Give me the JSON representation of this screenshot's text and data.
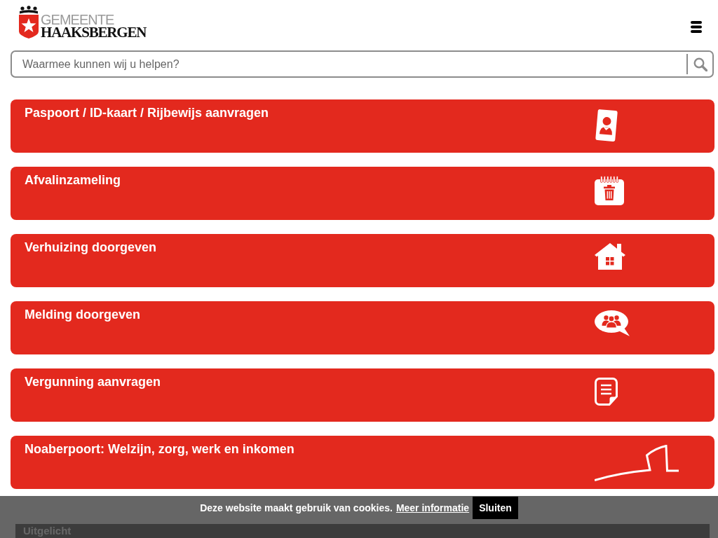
{
  "header": {
    "logo": {
      "line_1": "GEMEENTE",
      "line_2": "HAAKSBERGEN"
    }
  },
  "search": {
    "placeholder": "Waarmee kunnen wij u helpen?"
  },
  "tiles": [
    {
      "title": "Paspoort / ID-kaart / Rijbewijs aanvragen",
      "kind": "id-card"
    },
    {
      "title": "Afvalinzameling",
      "kind": "waste-calendar"
    },
    {
      "title": "Verhuizing doorgeven",
      "kind": "house"
    },
    {
      "title": "Melding doorgeven",
      "kind": "speech-bubble"
    },
    {
      "title": "Vergunning aanvragen",
      "kind": "document"
    },
    {
      "title": "Noaberpoort: Welzijn, zorg, werk en inkomen",
      "kind": "line-logo"
    }
  ],
  "featured": {
    "heading": "Uitgelicht"
  },
  "cookie_bar": {
    "message": "Deze website maakt gebruik van cookies.",
    "link": "Meer informatie",
    "button": "Sluiten"
  }
}
